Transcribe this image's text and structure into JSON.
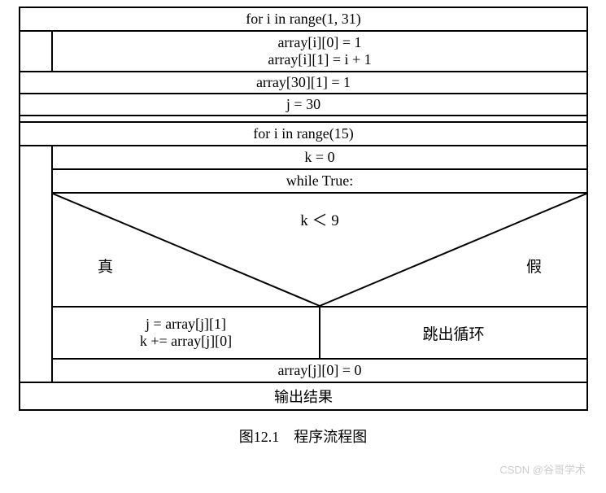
{
  "diagram": {
    "loop1_header": "for i in range(1, 31)",
    "loop1_body_line1": "array[i][0] = 1",
    "loop1_body_line2": "array[i][1] = i + 1",
    "stmt_after_loop1_a": "array[30][1] = 1",
    "stmt_after_loop1_b": "j = 30",
    "loop2_header": "for i in range(15)",
    "loop2_stmt1": "k = 0",
    "while_header": "while True:",
    "condition": "k ＜ 9",
    "true_label": "真",
    "false_label": "假",
    "true_branch_line1": "j = array[j][1]",
    "true_branch_line2": "k += array[j][0]",
    "false_branch": "跳出循环",
    "after_while": "array[j][0] = 0",
    "output": "输出结果"
  },
  "caption": "图12.1　程序流程图",
  "watermark": "CSDN @谷哥学术"
}
